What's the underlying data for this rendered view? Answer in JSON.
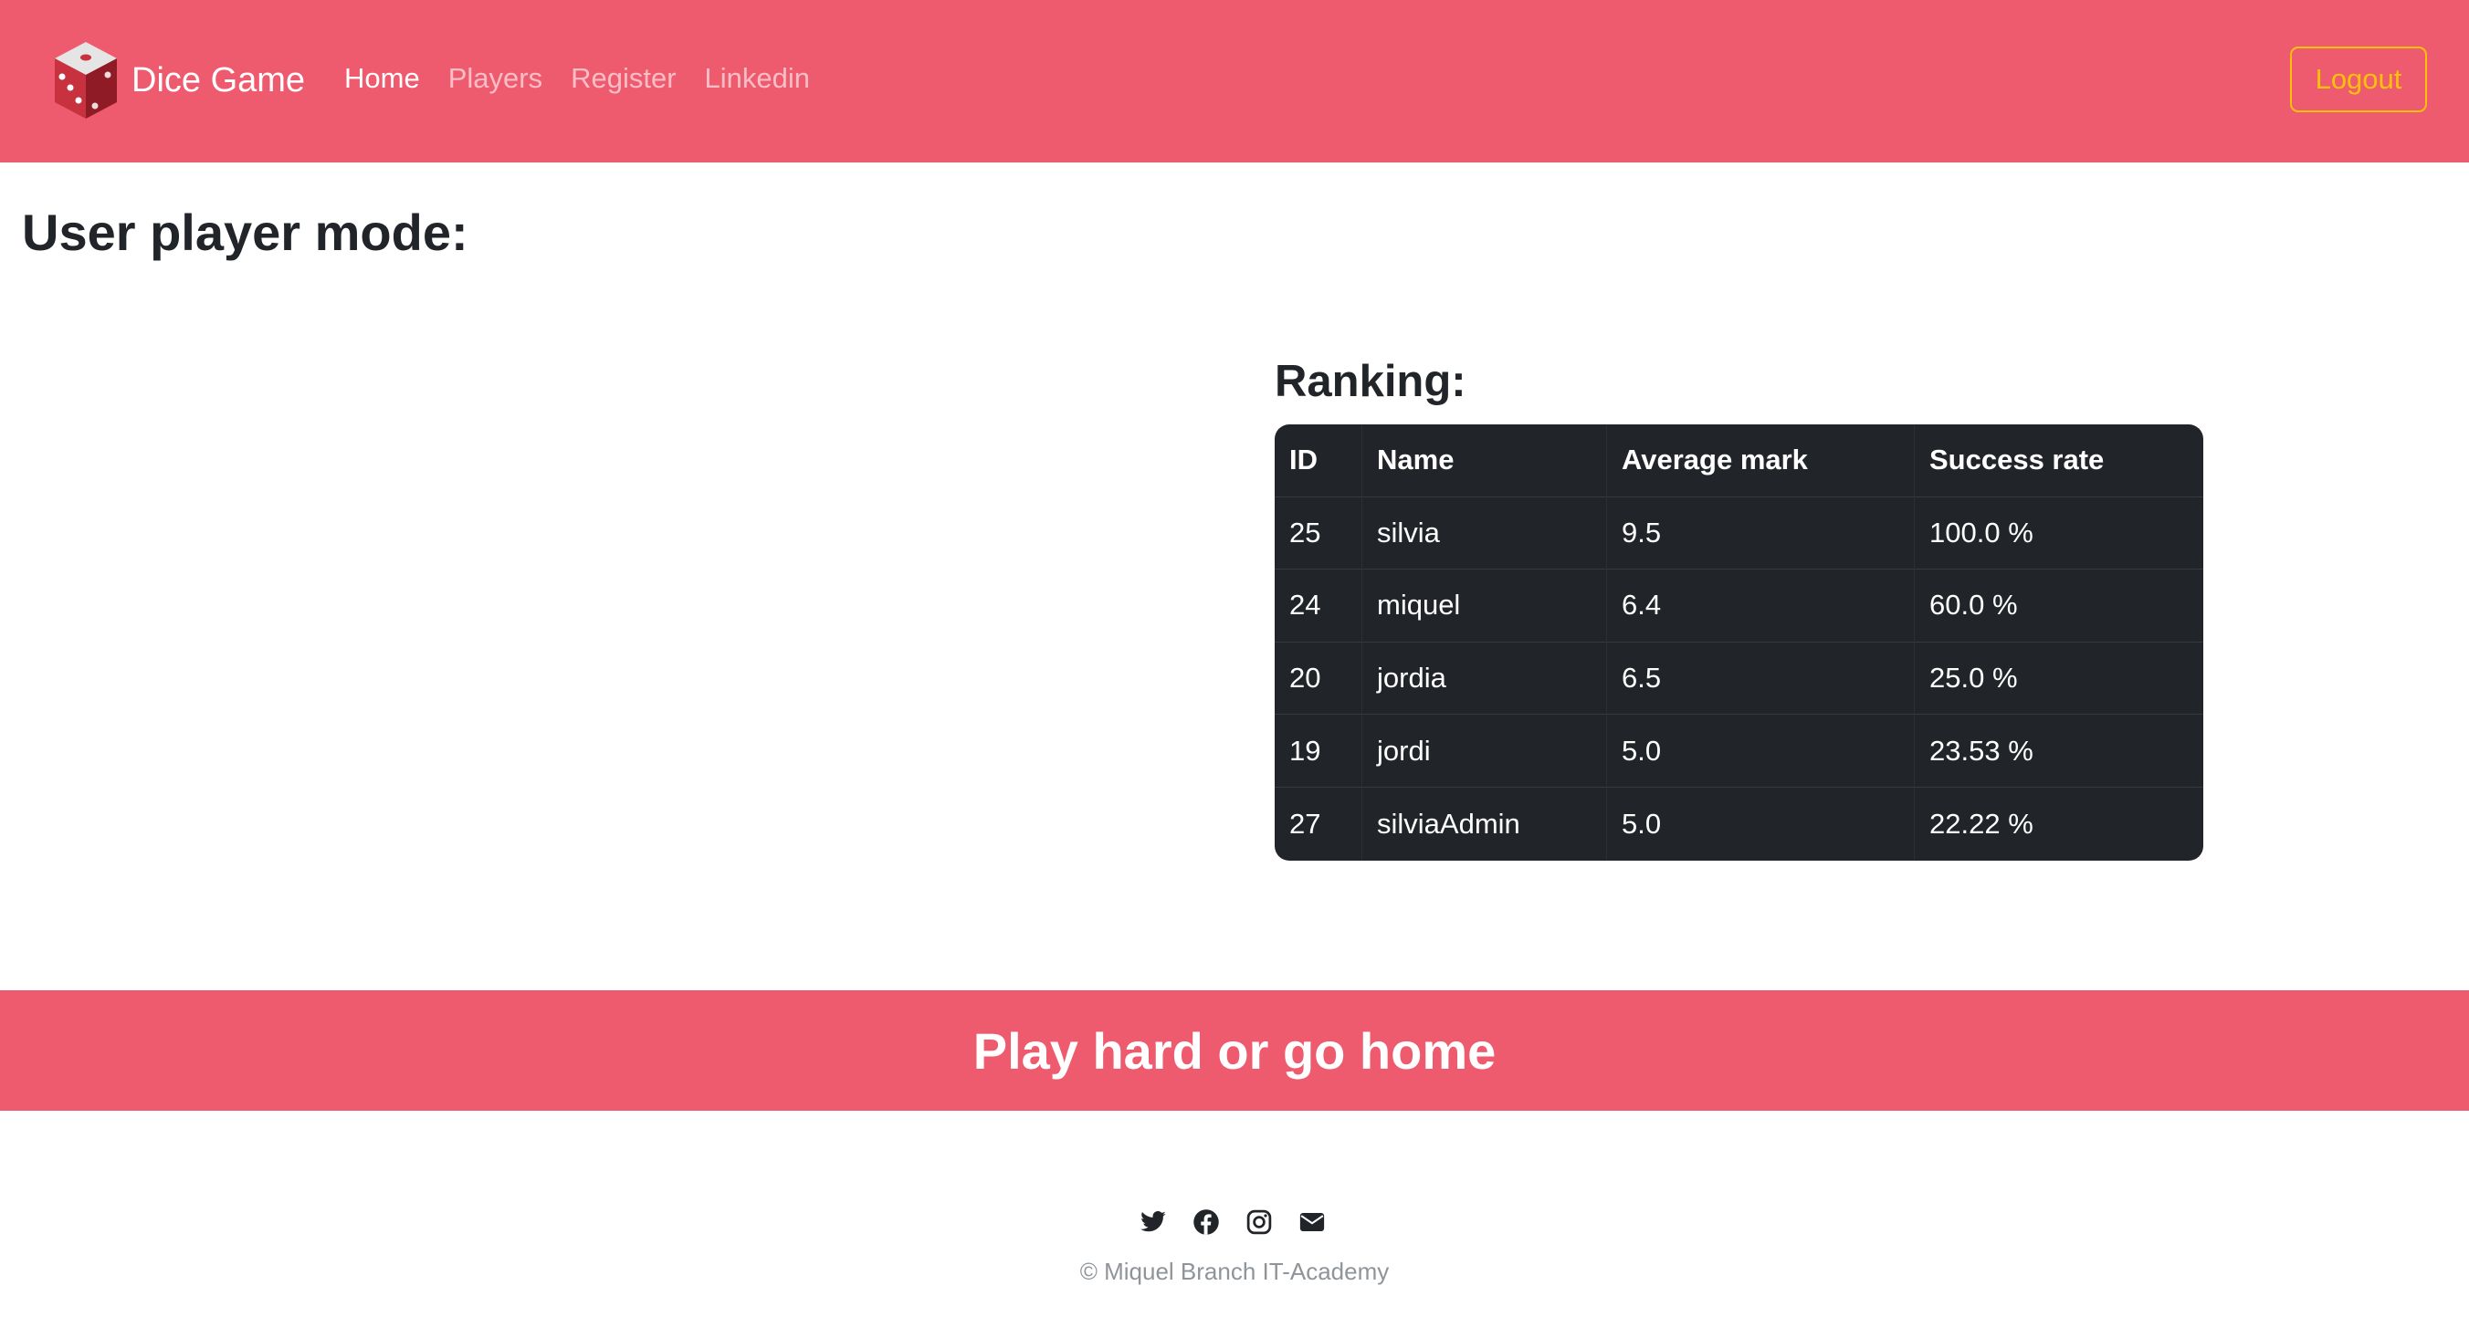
{
  "brand": {
    "name": "Dice Game",
    "logo": "dice-logo"
  },
  "nav": {
    "items": [
      {
        "label": "Home",
        "active": true
      },
      {
        "label": "Players",
        "active": false
      },
      {
        "label": "Register",
        "active": false
      },
      {
        "label": "Linkedin",
        "active": false
      }
    ],
    "logout_label": "Logout"
  },
  "page": {
    "title": "User player mode:"
  },
  "ranking": {
    "title": "Ranking:",
    "columns": [
      "ID",
      "Name",
      "Average mark",
      "Success rate"
    ],
    "rows": [
      {
        "id": "25",
        "name": "silvia",
        "average": "9.5",
        "success": "100.0 %"
      },
      {
        "id": "24",
        "name": "miquel",
        "average": "6.4",
        "success": "60.0 %"
      },
      {
        "id": "20",
        "name": "jordia",
        "average": "6.5",
        "success": "25.0 %"
      },
      {
        "id": "19",
        "name": "jordi",
        "average": "5.0",
        "success": "23.53 %"
      },
      {
        "id": "27",
        "name": "silviaAdmin",
        "average": "5.0",
        "success": "22.22 %"
      }
    ]
  },
  "banner": {
    "text": "Play hard or go home"
  },
  "footer": {
    "social_icons": [
      "twitter-icon",
      "facebook-icon",
      "instagram-icon",
      "envelope-icon"
    ],
    "copyright": "© Miquel Branch IT-Academy"
  },
  "colors": {
    "brand_pink": "#ee5b6e",
    "table_dark": "#212529",
    "warning": "#ffc107"
  }
}
